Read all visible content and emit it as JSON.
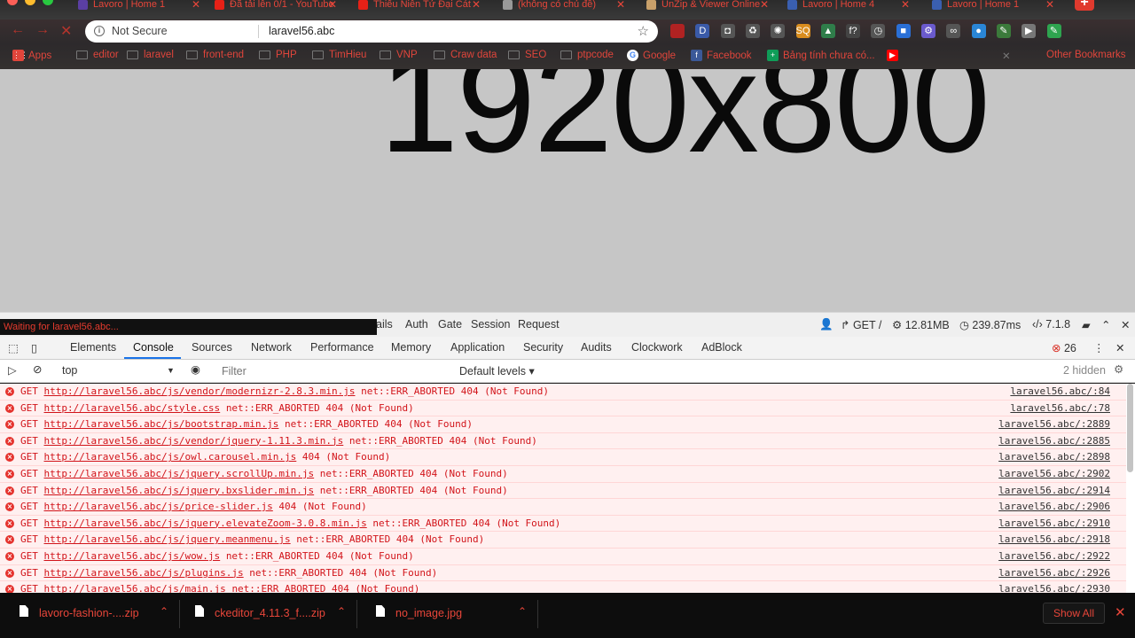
{
  "tabs": [
    {
      "title": "Lavoro | Home 1",
      "fav": "#5b3fa3"
    },
    {
      "title": "Đã tải lên 0/1 - YouTube",
      "fav": "#e62117"
    },
    {
      "title": "Thiếu Niên Tử Đại Cát",
      "fav": "#e62117"
    },
    {
      "title": "(không có chủ đề)",
      "fav": "#999999"
    },
    {
      "title": "UnZip & Viewer Online",
      "fav": "#c8a06a"
    },
    {
      "title": "Lavoro | Home 4",
      "fav": "#3a5fb0"
    },
    {
      "title": "Lavoro | Home 1",
      "fav": "#3a5fb0"
    }
  ],
  "tab_close_icon": "close-icon",
  "new_tab_label": "+",
  "toolbar": {
    "security_label": "Not Secure",
    "url": "laravel56.abc",
    "extensions": [
      {
        "name": "ublock-icon",
        "glyph": "",
        "color": "#b02222"
      },
      {
        "name": "d-extension-icon",
        "glyph": "D",
        "color": "#3a5aa8"
      },
      {
        "name": "camera-icon",
        "glyph": "◘",
        "color": "#555555"
      },
      {
        "name": "recycle-icon",
        "glyph": "♻",
        "color": "#555555"
      },
      {
        "name": "gear-extension-icon",
        "glyph": "✺",
        "color": "#555555"
      },
      {
        "name": "seo-quake-icon",
        "glyph": "SQ",
        "color": "#d98c1e"
      },
      {
        "name": "chart-icon",
        "glyph": "▲",
        "color": "#2f7d4a"
      },
      {
        "name": "font-icon",
        "glyph": "f?",
        "color": "#444444"
      },
      {
        "name": "clock-icon",
        "glyph": "◷",
        "color": "#555555"
      },
      {
        "name": "screen-icon",
        "glyph": "■",
        "color": "#2a6fd6"
      },
      {
        "name": "settings-icon",
        "glyph": "⚙",
        "color": "#6a5acd"
      },
      {
        "name": "link-icon",
        "glyph": "∞",
        "color": "#555555"
      },
      {
        "name": "globe-icon",
        "glyph": "●",
        "color": "#2a86d6"
      },
      {
        "name": "pen-icon",
        "glyph": "✎",
        "color": "#3b7a3b"
      },
      {
        "name": "play-icon",
        "glyph": "▶",
        "color": "#777777"
      },
      {
        "name": "color-picker-icon",
        "glyph": "✎",
        "color": "#2ea44f"
      }
    ]
  },
  "bookmarks": [
    {
      "label": "Apps",
      "type": "apps"
    },
    {
      "label": "editor",
      "type": "folder"
    },
    {
      "label": "laravel",
      "type": "folder"
    },
    {
      "label": "front-end",
      "type": "folder"
    },
    {
      "label": "PHP",
      "type": "folder"
    },
    {
      "label": "TimHieu",
      "type": "folder"
    },
    {
      "label": "VNP",
      "type": "folder"
    },
    {
      "label": "Craw data",
      "type": "folder"
    },
    {
      "label": "SEO",
      "type": "folder"
    },
    {
      "label": "ptpcode",
      "type": "folder"
    },
    {
      "label": "Google",
      "type": "google"
    },
    {
      "label": "Facebook",
      "type": "facebook"
    },
    {
      "label": "Bảng tính chưa có...",
      "type": "sheets"
    },
    {
      "label": "",
      "type": "youtube"
    }
  ],
  "other_bookmarks": "Other Bookmarks",
  "page": {
    "placeholder_text": "1920x800"
  },
  "waiting_status": "Waiting for laravel56.abc...",
  "debugbar": {
    "tabs": [
      "ails",
      "Auth",
      "Gate",
      "Session",
      "Request"
    ],
    "method": "GET /",
    "memory": "12.81MB",
    "time": "239.87ms",
    "version": "7.1.8"
  },
  "devtools": {
    "tabs": [
      "Elements",
      "Console",
      "Sources",
      "Network",
      "Performance",
      "Memory",
      "Application",
      "Security",
      "Audits",
      "Clockwork",
      "AdBlock"
    ],
    "active_tab": "Console",
    "error_count": "26",
    "context": "top",
    "filter_placeholder": "Filter",
    "levels": "Default levels ▾",
    "hidden": "2 hidden"
  },
  "console_rows": [
    {
      "url": "http://laravel56.abc/js/vendor/modernizr-2.8.3.min.js",
      "status": "net::ERR_ABORTED 404 (Not Found)",
      "source": "laravel56.abc/:84"
    },
    {
      "url": "http://laravel56.abc/style.css",
      "status": "net::ERR_ABORTED 404 (Not Found)",
      "source": "laravel56.abc/:78"
    },
    {
      "url": "http://laravel56.abc/js/bootstrap.min.js",
      "status": "net::ERR_ABORTED 404 (Not Found)",
      "source": "laravel56.abc/:2889"
    },
    {
      "url": "http://laravel56.abc/js/vendor/jquery-1.11.3.min.js",
      "status": "net::ERR_ABORTED 404 (Not Found)",
      "source": "laravel56.abc/:2885"
    },
    {
      "url": "http://laravel56.abc/js/owl.carousel.min.js",
      "status": "404 (Not Found)",
      "source": "laravel56.abc/:2898"
    },
    {
      "url": "http://laravel56.abc/js/jquery.scrollUp.min.js",
      "status": "net::ERR_ABORTED 404 (Not Found)",
      "source": "laravel56.abc/:2902"
    },
    {
      "url": "http://laravel56.abc/js/jquery.bxslider.min.js",
      "status": "net::ERR_ABORTED 404 (Not Found)",
      "source": "laravel56.abc/:2914"
    },
    {
      "url": "http://laravel56.abc/js/price-slider.js",
      "status": "404 (Not Found)",
      "source": "laravel56.abc/:2906"
    },
    {
      "url": "http://laravel56.abc/js/jquery.elevateZoom-3.0.8.min.js",
      "status": "net::ERR_ABORTED 404 (Not Found)",
      "source": "laravel56.abc/:2910"
    },
    {
      "url": "http://laravel56.abc/js/jquery.meanmenu.js",
      "status": "net::ERR_ABORTED 404 (Not Found)",
      "source": "laravel56.abc/:2918"
    },
    {
      "url": "http://laravel56.abc/js/wow.js",
      "status": "net::ERR_ABORTED 404 (Not Found)",
      "source": "laravel56.abc/:2922"
    },
    {
      "url": "http://laravel56.abc/js/plugins.js",
      "status": "net::ERR_ABORTED 404 (Not Found)",
      "source": "laravel56.abc/:2926"
    },
    {
      "url": "http://laravel56.abc/js/main.js",
      "status": "net::ERR_ABORTED 404 (Not Found)",
      "source": "laravel56.abc/:2930"
    }
  ],
  "console_method": "GET",
  "downloads": [
    {
      "name": "lavoro-fashion-....zip"
    },
    {
      "name": "ckeditor_4.11.3_f....zip"
    },
    {
      "name": "no_image.jpg"
    }
  ],
  "show_all": "Show All",
  "colors": {
    "accent_red": "#e8463a",
    "error_red": "#d2141a",
    "devtools_blue": "#1a73e8"
  }
}
